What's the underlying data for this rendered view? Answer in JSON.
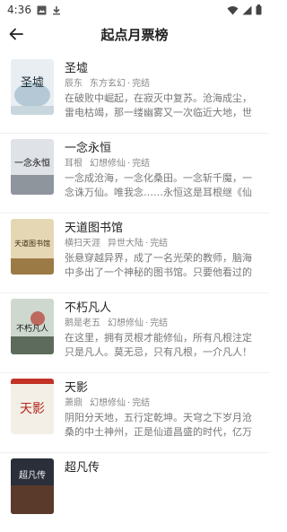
{
  "status_bar": {
    "time": "4:36"
  },
  "app_bar": {
    "title": "起点月票榜"
  },
  "books": [
    {
      "title": "圣墟",
      "author": "辰东",
      "genre": "东方玄幻",
      "status": "完结",
      "desc": "在破败中崛起，在寂灭中复苏。沧海成尘，雷电枯竭，那一缕幽雾又一次临近大地，世间…",
      "cover": "圣墟"
    },
    {
      "title": "一念永恒",
      "author": "耳根",
      "genre": "幻想修仙",
      "status": "完结",
      "desc": "一念成沧海，一念化桑田。一念斩千魔，一念诛万仙。唯我念……永恒这是耳根继《仙逆》…",
      "cover": "一念永恒"
    },
    {
      "title": "天道图书馆",
      "author": "横扫天涯",
      "genre": "异世大陆",
      "status": "完结",
      "desc": "张悬穿越异界，成了一名光荣的教师，脑海中多出了一个神秘的图书馆。只要他看过的东…",
      "cover": "天道图书馆"
    },
    {
      "title": "不朽凡人",
      "author": "鹅是老五",
      "genre": "幻想修仙",
      "status": "完结",
      "desc": "在这里，拥有灵根才能修仙，所有凡根注定只是凡人。莫无忌，只有凡根，一介凡人！",
      "cover": "不朽凡人"
    },
    {
      "title": "天影",
      "author": "萧鼎",
      "genre": "幻想修仙",
      "status": "完结",
      "desc": "阴阳分天地，五行定乾坤。天穹之下岁月沧桑的中土神州，正是仙道昌盛的时代，亿万生…",
      "cover": "天影"
    },
    {
      "title": "超凡传",
      "author": "",
      "genre": "",
      "status": "",
      "desc": "",
      "cover": "超凡传"
    }
  ]
}
